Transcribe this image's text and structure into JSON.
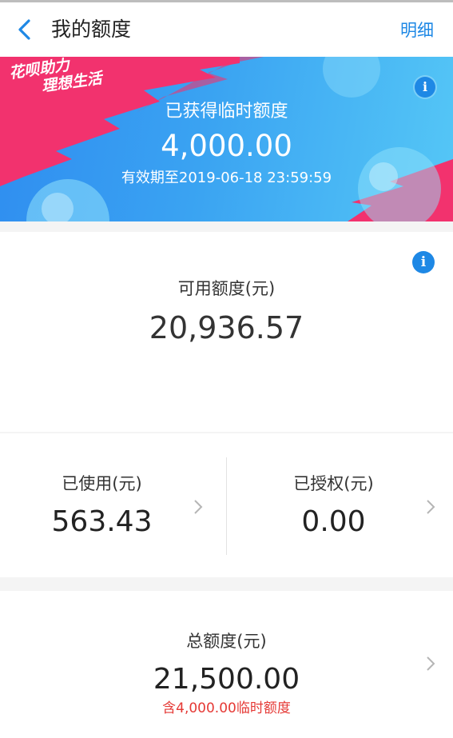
{
  "nav": {
    "title": "我的额度",
    "detail_label": "明细"
  },
  "banner": {
    "slogan_line1": "花呗助力",
    "slogan_line2": "理想生活",
    "label": "已获得临时额度",
    "amount": "4,000.00",
    "valid_until": "有效期至2019-06-18 23:59:59",
    "info_glyph": "i"
  },
  "available": {
    "label": "可用额度(元)",
    "amount": "20,936.57",
    "info_glyph": "i"
  },
  "used": {
    "label": "已使用(元)",
    "amount": "563.43"
  },
  "authorized": {
    "label": "已授权(元)",
    "amount": "0.00"
  },
  "total": {
    "label": "总额度(元)",
    "amount": "21,500.00",
    "note": "含4,000.00临时额度"
  },
  "colors": {
    "accent": "#1E88E5",
    "banner_pink": "#F2326E",
    "note_red": "#E53935"
  },
  "icons": [
    "back-arrow-icon",
    "info-icon",
    "chevron-right-icon"
  ]
}
